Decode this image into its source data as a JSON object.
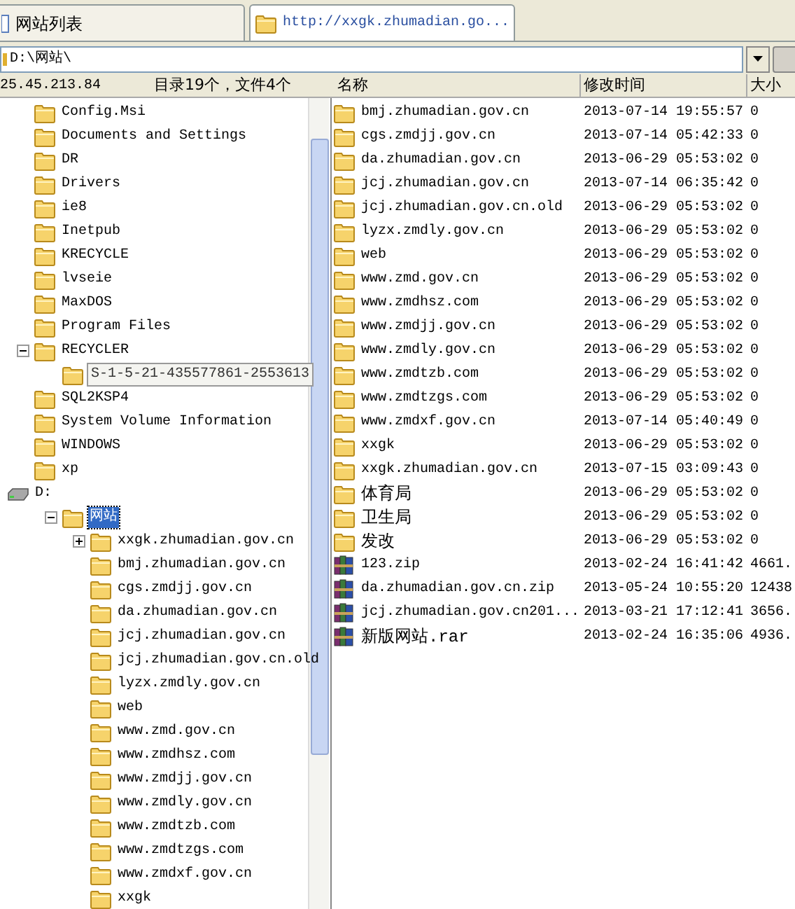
{
  "tabs": [
    {
      "label": "网站列表",
      "kind": "page",
      "selected": false
    },
    {
      "label": "http://xxgk.zhumadian.go...",
      "kind": "folder",
      "selected": true
    }
  ],
  "address": {
    "value": "D:\\网站\\"
  },
  "status": {
    "host": "25.45.213.84",
    "summary": "目录19个，文件4个"
  },
  "tree": [
    {
      "children": [
        {
          "label": "Config.Msi"
        },
        {
          "label": "Documents and Settings"
        },
        {
          "label": "DR"
        },
        {
          "label": "Drivers"
        },
        {
          "label": "ie8"
        },
        {
          "label": "Inetpub"
        },
        {
          "label": "KRECYCLE"
        },
        {
          "label": "lvseie"
        },
        {
          "label": "MaxDOS"
        },
        {
          "label": "Program Files"
        },
        {
          "label": "RECYCLER",
          "expanded": true,
          "children": [
            {
              "label": "S-1-5-21-435577861-2553613",
              "kind": "tooltip"
            }
          ]
        },
        {
          "label": "SQL2KSP4"
        },
        {
          "label": "System Volume Information"
        },
        {
          "label": "WINDOWS"
        },
        {
          "label": "xp"
        }
      ]
    },
    {
      "label": "D:",
      "kind": "drive",
      "children": [
        {
          "label": "网站",
          "expanded": true,
          "selected": true,
          "children": [
            {
              "label": "xxgk.zhumadian.gov.cn",
              "expanded": false
            },
            {
              "label": "bmj.zhumadian.gov.cn"
            },
            {
              "label": "cgs.zmdjj.gov.cn"
            },
            {
              "label": "da.zhumadian.gov.cn"
            },
            {
              "label": "jcj.zhumadian.gov.cn"
            },
            {
              "label": "jcj.zhumadian.gov.cn.old"
            },
            {
              "label": "lyzx.zmdly.gov.cn"
            },
            {
              "label": "web"
            },
            {
              "label": "www.zmd.gov.cn"
            },
            {
              "label": "www.zmdhsz.com"
            },
            {
              "label": "www.zmdjj.gov.cn"
            },
            {
              "label": "www.zmdly.gov.cn"
            },
            {
              "label": "www.zmdtzb.com"
            },
            {
              "label": "www.zmdtzgs.com"
            },
            {
              "label": "www.zmdxf.gov.cn"
            },
            {
              "label": "xxgk"
            }
          ]
        }
      ]
    }
  ],
  "columns": [
    "名称",
    "修改时间",
    "大小"
  ],
  "files": [
    {
      "kind": "folder",
      "name": "bmj.zhumadian.gov.cn",
      "modified": "2013-07-14 19:55:57",
      "size": "0"
    },
    {
      "kind": "folder",
      "name": "cgs.zmdjj.gov.cn",
      "modified": "2013-07-14 05:42:33",
      "size": "0"
    },
    {
      "kind": "folder",
      "name": "da.zhumadian.gov.cn",
      "modified": "2013-06-29 05:53:02",
      "size": "0"
    },
    {
      "kind": "folder",
      "name": "jcj.zhumadian.gov.cn",
      "modified": "2013-07-14 06:35:42",
      "size": "0"
    },
    {
      "kind": "folder",
      "name": "jcj.zhumadian.gov.cn.old",
      "modified": "2013-06-29 05:53:02",
      "size": "0"
    },
    {
      "kind": "folder",
      "name": "lyzx.zmdly.gov.cn",
      "modified": "2013-06-29 05:53:02",
      "size": "0"
    },
    {
      "kind": "folder",
      "name": "web",
      "modified": "2013-06-29 05:53:02",
      "size": "0"
    },
    {
      "kind": "folder",
      "name": "www.zmd.gov.cn",
      "modified": "2013-06-29 05:53:02",
      "size": "0"
    },
    {
      "kind": "folder",
      "name": "www.zmdhsz.com",
      "modified": "2013-06-29 05:53:02",
      "size": "0"
    },
    {
      "kind": "folder",
      "name": "www.zmdjj.gov.cn",
      "modified": "2013-06-29 05:53:02",
      "size": "0"
    },
    {
      "kind": "folder",
      "name": "www.zmdly.gov.cn",
      "modified": "2013-06-29 05:53:02",
      "size": "0"
    },
    {
      "kind": "folder",
      "name": "www.zmdtzb.com",
      "modified": "2013-06-29 05:53:02",
      "size": "0"
    },
    {
      "kind": "folder",
      "name": "www.zmdtzgs.com",
      "modified": "2013-06-29 05:53:02",
      "size": "0"
    },
    {
      "kind": "folder",
      "name": "www.zmdxf.gov.cn",
      "modified": "2013-07-14 05:40:49",
      "size": "0"
    },
    {
      "kind": "folder",
      "name": "xxgk",
      "modified": "2013-06-29 05:53:02",
      "size": "0"
    },
    {
      "kind": "folder",
      "name": "xxgk.zhumadian.gov.cn",
      "modified": "2013-07-15 03:09:43",
      "size": "0"
    },
    {
      "kind": "folder",
      "name": "体育局",
      "modified": "2013-06-29 05:53:02",
      "size": "0"
    },
    {
      "kind": "folder",
      "name": "卫生局",
      "modified": "2013-06-29 05:53:02",
      "size": "0"
    },
    {
      "kind": "folder",
      "name": "发改",
      "modified": "2013-06-29 05:53:02",
      "size": "0"
    },
    {
      "kind": "archive",
      "name": "123.zip",
      "modified": "2013-02-24 16:41:42",
      "size": "4661."
    },
    {
      "kind": "archive",
      "name": "da.zhumadian.gov.cn.zip",
      "modified": "2013-05-24 10:55:20",
      "size": "12438"
    },
    {
      "kind": "archive",
      "name": "jcj.zhumadian.gov.cn201...",
      "modified": "2013-03-21 17:12:41",
      "size": "3656."
    },
    {
      "kind": "archive",
      "name": "新版网站.rar",
      "modified": "2013-02-24 16:35:06",
      "size": "4936."
    }
  ]
}
